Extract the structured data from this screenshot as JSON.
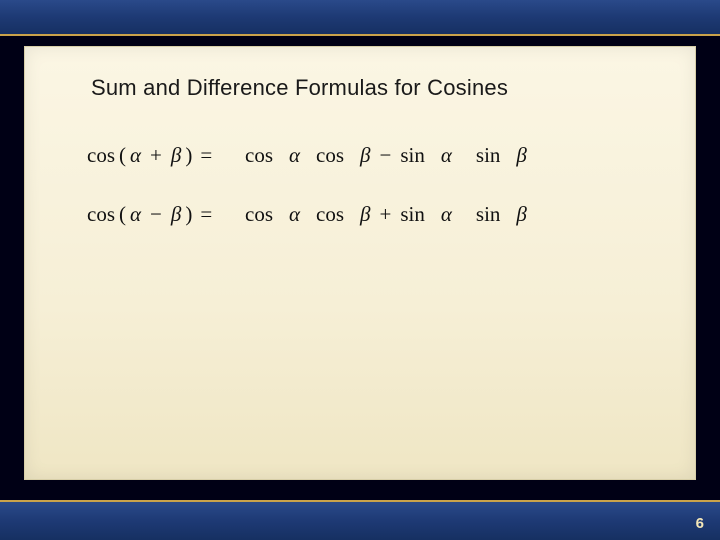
{
  "heading": "Sum and Difference Formulas for Cosines",
  "page_number": "6",
  "symbols": {
    "alpha": "α",
    "beta": "β",
    "plus": "+",
    "minus": "−",
    "equals": "=",
    "lparen": "(",
    "rparen": ")"
  },
  "fn": {
    "cos": "cos",
    "sin": "sin"
  },
  "formulas": [
    {
      "lhs_inner_op": "plus",
      "rhs_middle_op": "minus"
    },
    {
      "lhs_inner_op": "minus",
      "rhs_middle_op": "plus"
    }
  ]
}
